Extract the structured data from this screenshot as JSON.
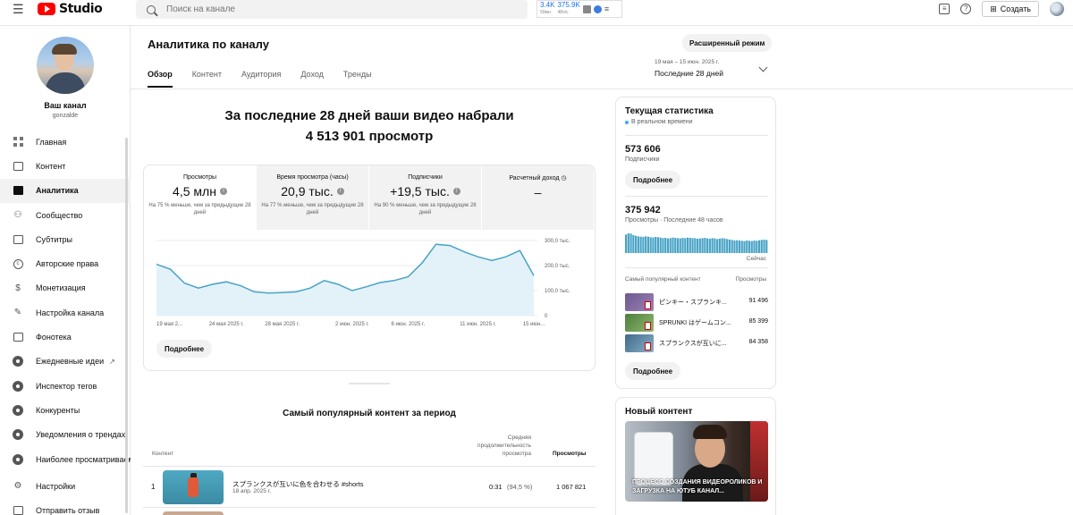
{
  "header": {
    "logo_text": "Studio",
    "search_placeholder": "Поиск на канале",
    "ext": {
      "stat1": "3.4K",
      "stat1_sub": "50мн",
      "stat2": "375.9K",
      "stat2_sub": "48ч/с"
    },
    "create_label": "Создать"
  },
  "sidebar": {
    "channel_title": "Ваш канал",
    "channel_handle": "gonzalde",
    "items": [
      {
        "label": "Главная",
        "icon": "dashboard-icon"
      },
      {
        "label": "Контент",
        "icon": "content-icon"
      },
      {
        "label": "Аналитика",
        "icon": "analytics-icon",
        "active": true
      },
      {
        "label": "Сообщество",
        "icon": "community-icon"
      },
      {
        "label": "Субтитры",
        "icon": "subtitles-icon"
      },
      {
        "label": "Авторские права",
        "icon": "copyright-icon"
      },
      {
        "label": "Монетизация",
        "icon": "monetization-icon"
      },
      {
        "label": "Настройка канала",
        "icon": "customization-icon"
      },
      {
        "label": "Фонотека",
        "icon": "audio-library-icon"
      },
      {
        "label": "Ежедневные идеи",
        "icon": "ideas-icon"
      },
      {
        "label": "Инспектор тегов",
        "icon": "tag-inspector-icon"
      },
      {
        "label": "Конкуренты",
        "icon": "competitors-icon"
      },
      {
        "label": "Уведомления о трендах",
        "icon": "trend-alerts-icon"
      },
      {
        "label": "Наиболее просматриваемые",
        "icon": "most-viewed-icon"
      },
      {
        "label": "Настройки",
        "icon": "settings-icon"
      },
      {
        "label": "Отправить отзыв",
        "icon": "feedback-icon"
      }
    ]
  },
  "main": {
    "title": "Аналитика по каналу",
    "advanced_mode": "Расширенный режим",
    "tabs": [
      "Обзор",
      "Контент",
      "Аудитория",
      "Доход",
      "Тренды"
    ],
    "date_range": {
      "dates": "19 мая – 15 июн. 2025 г.",
      "period": "Последние 28 дней"
    },
    "headline_line1": "За последние 28 дней ваши видео набрали",
    "headline_line2": "4 513 901 просмотр",
    "metrics": [
      {
        "label": "Просмотры",
        "value": "4,5 млн",
        "compare": "На 75 % меньше, чем за предыдущие 28 дней"
      },
      {
        "label": "Время просмотра (часы)",
        "value": "20,9 тыс.",
        "compare": "На 77 % меньше, чем за предыдущие 28 дней"
      },
      {
        "label": "Подписчики",
        "value": "+19,5 тыс.",
        "compare": "На 90 % меньше, чем за предыдущие 28 дней"
      },
      {
        "label": "Расчетный доход",
        "value": "–",
        "compare": ""
      }
    ],
    "more_button": "Подробнее",
    "top_content": {
      "title": "Самый популярный контент за период",
      "col_content": "Контент",
      "col_avg": "Средняя продолжительность просмотра",
      "col_views": "Просмотры",
      "rows": [
        {
          "rank": "1",
          "title": "スプランクスが互いに色を合わせる #shorts",
          "date": "18 апр. 2025 г.",
          "avg": "0:31",
          "avg_pct": "(94,5 %)",
          "views": "1 067 821"
        }
      ]
    }
  },
  "chart_data": {
    "type": "area",
    "x_tick_labels": [
      "19 мая 2...",
      "24 мая 2025 г.",
      "28 мая 2025 г.",
      "2 июн. 2025 г.",
      "6 июн. 2025 г.",
      "11 июн. 2025 г.",
      "15 июн..."
    ],
    "y_tick_labels": [
      "300,0 тыс.",
      "200,0 тыс.",
      "100,0 тыс.",
      "0"
    ],
    "ylim": [
      0,
      300000
    ],
    "series": [
      {
        "values": [
          205000,
          185000,
          130000,
          110000,
          125000,
          135000,
          120000,
          95000,
          90000,
          92000,
          95000,
          110000,
          140000,
          125000,
          100000,
          115000,
          132000,
          140000,
          155000,
          210000,
          285000,
          280000,
          255000,
          235000,
          220000,
          235000,
          260000,
          160000
        ]
      }
    ],
    "grid": true,
    "color": "#48a3c6"
  },
  "realtime": {
    "title": "Текущая статистика",
    "live_label": "В реальном времени",
    "subs_value": "573 606",
    "subs_label": "Подписчики",
    "more_button": "Подробнее",
    "views_value": "375 942",
    "views_label": "Просмотры · Последние 48 часов",
    "now_label": "Сейчас",
    "popular_label": "Самый популярный контент",
    "views_col": "Просмотры",
    "rows": [
      {
        "title": "ピンキー・スプランキ...",
        "views": "91 496"
      },
      {
        "title": "SPRUNKI はゲームコン...",
        "views": "85 399"
      },
      {
        "title": "スプランクスが互いに...",
        "views": "84 358"
      }
    ],
    "more_button2": "Подробнее",
    "bars": [
      0.62,
      0.66,
      0.65,
      0.6,
      0.58,
      0.56,
      0.55,
      0.54,
      0.56,
      0.55,
      0.53,
      0.52,
      0.54,
      0.53,
      0.52,
      0.5,
      0.51,
      0.49,
      0.5,
      0.52,
      0.51,
      0.5,
      0.49,
      0.51,
      0.5,
      0.52,
      0.51,
      0.5,
      0.5,
      0.48,
      0.49,
      0.5,
      0.51,
      0.49,
      0.48,
      0.5,
      0.49,
      0.47,
      0.48,
      0.5,
      0.49,
      0.47,
      0.45,
      0.44,
      0.42,
      0.43,
      0.42,
      0.41,
      0.4,
      0.42,
      0.41,
      0.4,
      0.42,
      0.41,
      0.43,
      0.44,
      0.45,
      0.44
    ]
  },
  "new_content": {
    "title": "Новый контент",
    "caption": "ПРОЦЕСС СОЗДАНИЯ ВИДЕОРОЛИКОВ И ЗАГРУЗКА НА ЮТУБ КАНАЛ..."
  }
}
